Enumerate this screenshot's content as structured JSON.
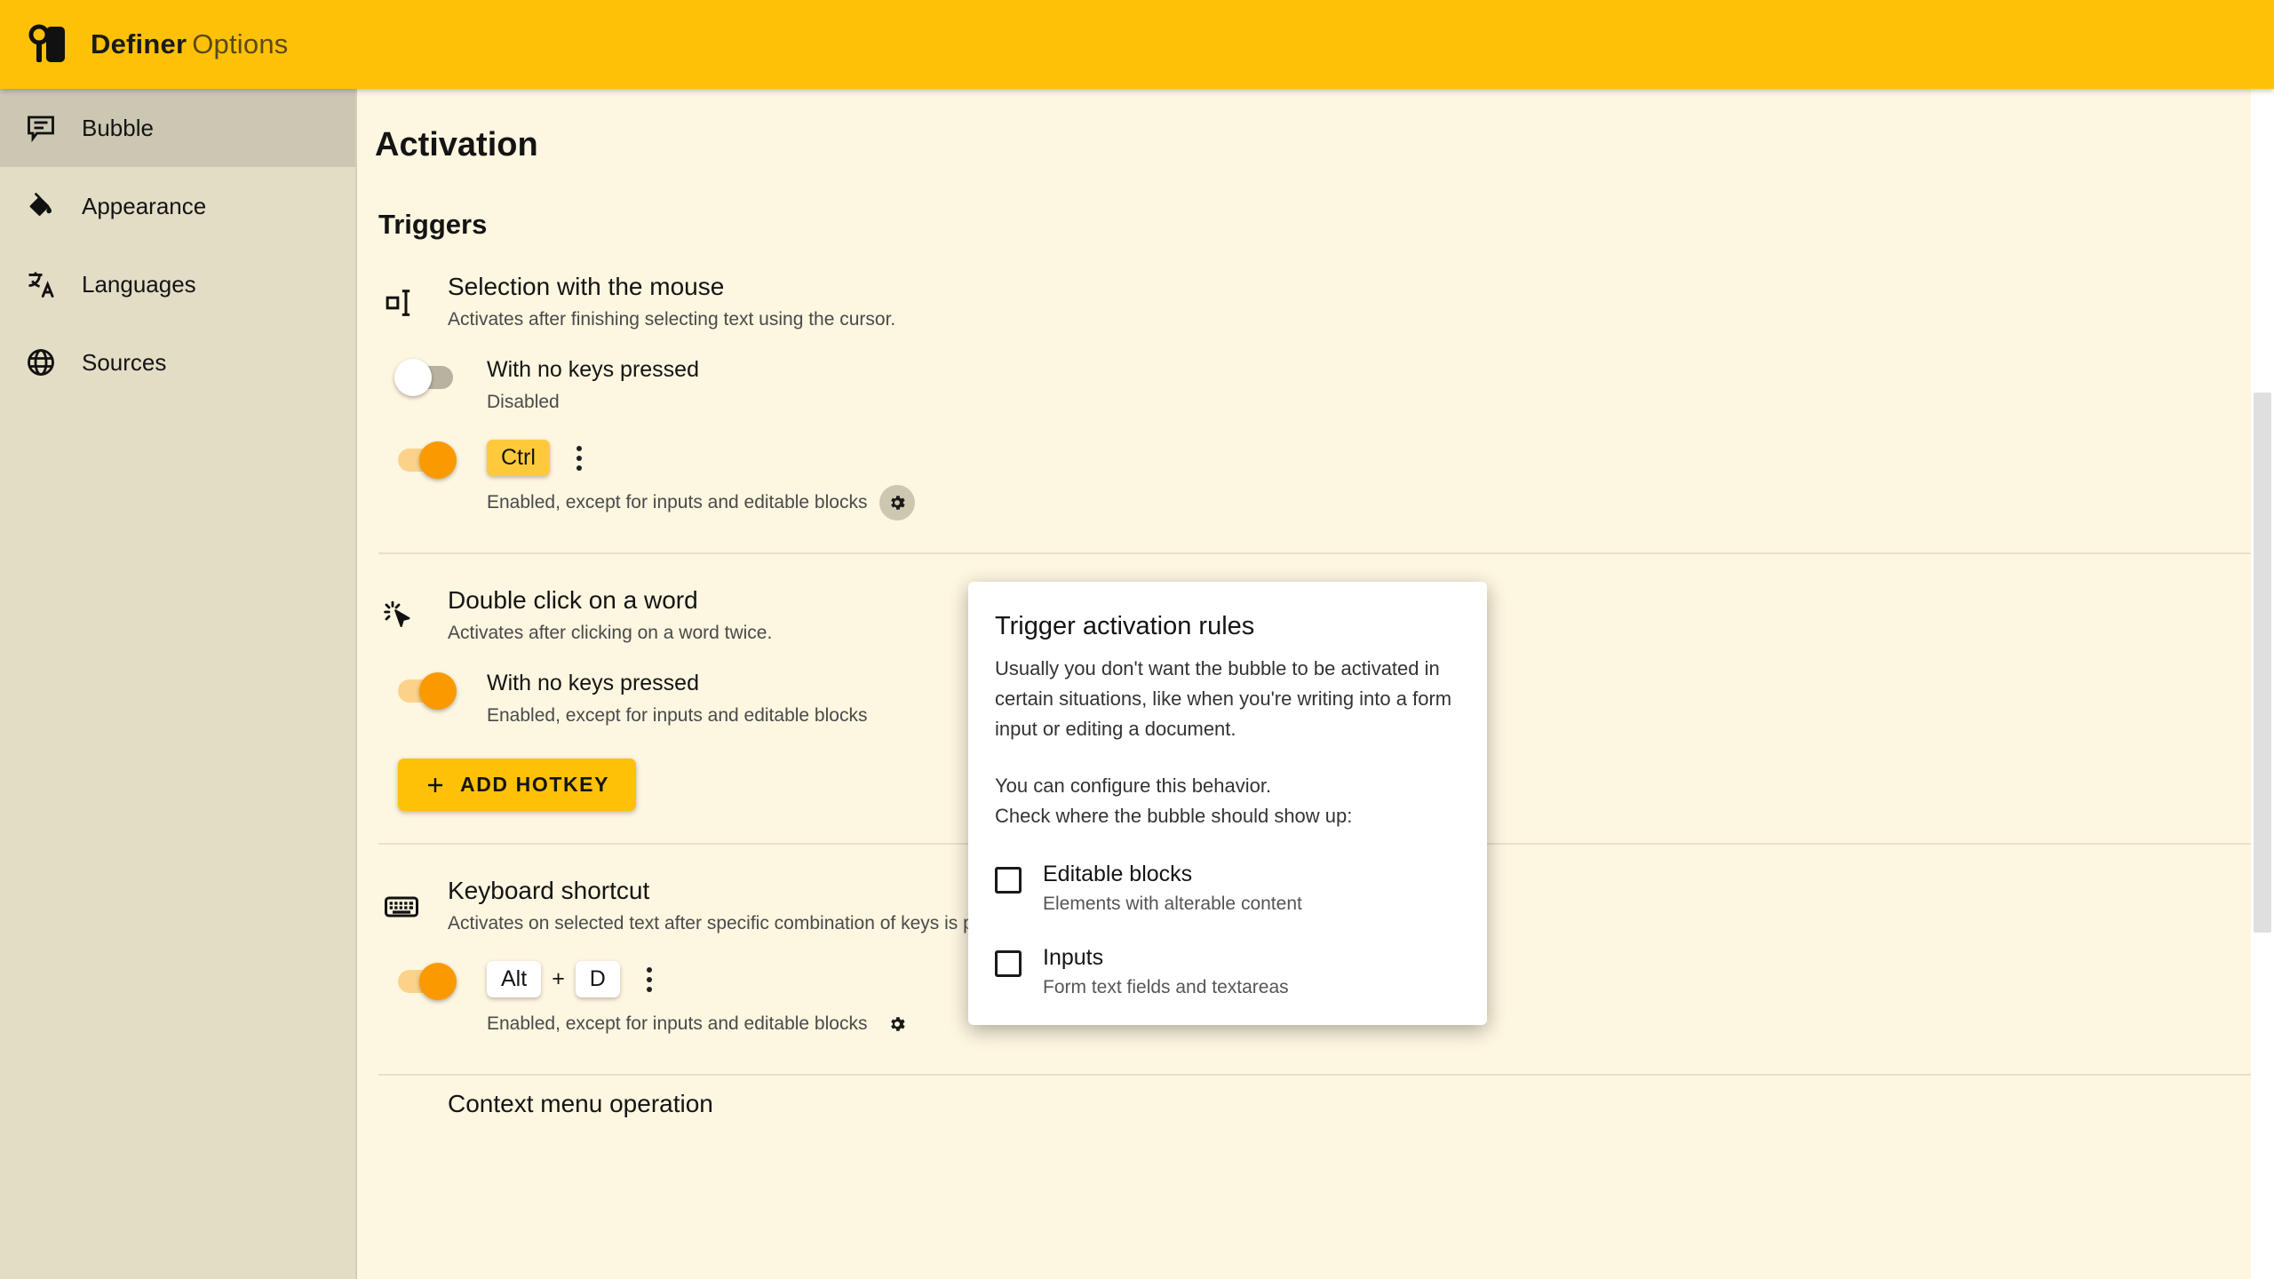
{
  "header": {
    "brand": "Definer",
    "subtitle": "Options",
    "logo_icon": "definer-logo-icon"
  },
  "sidebar": {
    "items": [
      {
        "label": "Bubble",
        "icon": "speech-bubble-icon",
        "active": true
      },
      {
        "label": "Appearance",
        "icon": "paint-bucket-icon",
        "active": false
      },
      {
        "label": "Languages",
        "icon": "translate-icon",
        "active": false
      },
      {
        "label": "Sources",
        "icon": "globe-icon",
        "active": false
      }
    ]
  },
  "main": {
    "page_title": "Activation",
    "section_title": "Triggers",
    "triggers": [
      {
        "name": "Selection with the mouse",
        "desc": "Activates after finishing selecting text using the cursor.",
        "icon": "text-select-icon",
        "rows": [
          {
            "label": "With no keys pressed",
            "status": "Disabled",
            "toggle": "off",
            "has_gear": false,
            "keys": []
          },
          {
            "label": "",
            "status": "Enabled, except for inputs and editable blocks",
            "toggle": "on",
            "has_gear": true,
            "gear_highlight": true,
            "keys": [
              "Ctrl"
            ],
            "key_style": "yellow",
            "has_kebab": true
          }
        ]
      },
      {
        "name": "Double click on a word",
        "desc": "Activates after clicking on a word twice.",
        "icon": "double-click-icon",
        "rows": [
          {
            "label": "With no keys pressed",
            "status": "Enabled, except for inputs and editable blocks",
            "toggle": "on",
            "has_gear": true,
            "gear_highlight": false,
            "keys": []
          }
        ],
        "add_button": "ADD HOTKEY"
      },
      {
        "name": "Keyboard shortcut",
        "desc": "Activates on selected text after specific combination of keys is pressed.",
        "icon": "keyboard-icon",
        "rows": [
          {
            "label": "",
            "status": "Enabled, except for inputs and editable blocks",
            "toggle": "on",
            "has_gear": true,
            "gear_highlight": false,
            "keys": [
              "Alt",
              "D"
            ],
            "key_style": "white",
            "key_separator": "+",
            "has_kebab": true
          }
        ]
      }
    ],
    "next_section_partial": "Context menu operation"
  },
  "popover": {
    "title": "Trigger activation rules",
    "paragraph1": "Usually you don't want the bubble to be activated in certain situations, like when you're writing into a form input or editing a document.",
    "paragraph2_line1": "You can configure this behavior.",
    "paragraph2_line2": "Check where the bubble should show up:",
    "options": [
      {
        "title": "Editable blocks",
        "desc": "Elements with alterable content",
        "checked": false
      },
      {
        "title": "Inputs",
        "desc": "Form text fields and textareas",
        "checked": false
      }
    ]
  },
  "colors": {
    "brand_yellow": "#FFC107",
    "toggle_on": "#FB9A00",
    "page_bg": "#FDF6E0",
    "sidebar_bg": "#E3DDC6",
    "sidebar_active": "#CCC7B2"
  }
}
